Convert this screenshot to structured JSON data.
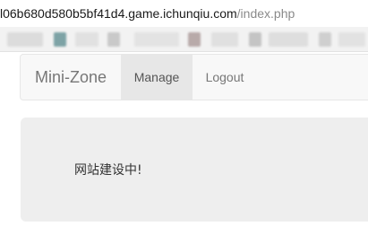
{
  "browser": {
    "url_host": "l06b680d580b5bf41d4.game.ichunqiu.com",
    "url_path": "/index.php"
  },
  "navbar": {
    "brand": "Mini-Zone",
    "items": [
      {
        "label": "Manage",
        "active": true
      },
      {
        "label": "Logout",
        "active": false
      }
    ]
  },
  "main": {
    "message": "网站建设中!"
  }
}
